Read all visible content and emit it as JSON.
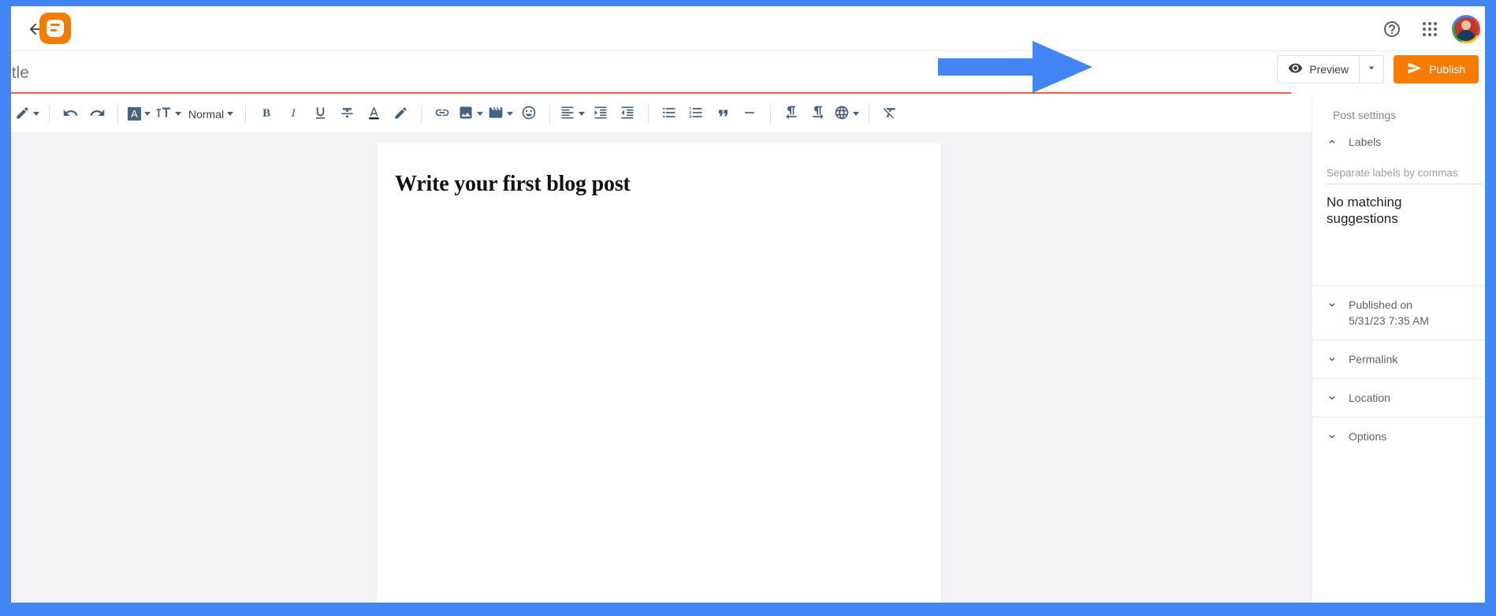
{
  "app": {
    "name": "Blogger",
    "accent_orange": "#f57c00",
    "annotation_color": "#4285f4",
    "title_underline_color": "#e8643c",
    "toolbar_icon_color": "#46637f"
  },
  "appbar": {
    "back_icon": "arrow-back-icon",
    "logo_icon": "blogger-logo-icon",
    "help_icon": "help-icon",
    "apps_icon": "apps-grid-icon",
    "avatar_icon": "account-avatar"
  },
  "title": {
    "placeholder": "Title",
    "value": ""
  },
  "actions": {
    "preview_label": "Preview",
    "preview_icon": "eye-icon",
    "preview_caret_icon": "chevron-down-icon",
    "publish_label": "Publish",
    "publish_icon": "send-icon"
  },
  "toolbar": {
    "items": [
      {
        "name": "edit-mode",
        "icon": "pencil-icon",
        "caret": true
      },
      {
        "name": "separator-1",
        "icon": "separator",
        "caret": false
      },
      {
        "name": "undo",
        "icon": "undo-icon",
        "caret": false
      },
      {
        "name": "redo",
        "icon": "redo-icon",
        "caret": false
      },
      {
        "name": "separator-2",
        "icon": "separator",
        "caret": false
      },
      {
        "name": "font-family",
        "icon": "letter-a-box-icon",
        "caret": true
      },
      {
        "name": "font-size",
        "icon": "format-size-icon",
        "caret": true
      },
      {
        "name": "paragraph-style",
        "icon": "text-label",
        "label": "Normal",
        "caret": true
      },
      {
        "name": "separator-3",
        "icon": "separator",
        "caret": false
      },
      {
        "name": "bold",
        "icon": "bold-icon",
        "label": "B",
        "caret": false
      },
      {
        "name": "italic",
        "icon": "italic-icon",
        "label": "I",
        "caret": false
      },
      {
        "name": "underline",
        "icon": "underline-icon",
        "caret": false
      },
      {
        "name": "strikethrough",
        "icon": "strikethrough-icon",
        "caret": false
      },
      {
        "name": "text-color",
        "icon": "text-color-icon",
        "caret": false
      },
      {
        "name": "highlight-color",
        "icon": "highlighter-icon",
        "caret": false
      },
      {
        "name": "separator-4",
        "icon": "separator",
        "caret": false
      },
      {
        "name": "insert-link",
        "icon": "link-icon",
        "caret": false
      },
      {
        "name": "insert-image",
        "icon": "image-icon",
        "caret": true
      },
      {
        "name": "insert-video",
        "icon": "video-icon",
        "caret": true
      },
      {
        "name": "insert-emoji",
        "icon": "emoji-icon",
        "caret": false
      },
      {
        "name": "separator-5",
        "icon": "separator",
        "caret": false
      },
      {
        "name": "align",
        "icon": "align-left-icon",
        "caret": true
      },
      {
        "name": "increase-indent",
        "icon": "indent-increase-icon",
        "caret": false
      },
      {
        "name": "decrease-indent",
        "icon": "indent-decrease-icon",
        "caret": false
      },
      {
        "name": "separator-6",
        "icon": "separator",
        "caret": false
      },
      {
        "name": "bulleted-list",
        "icon": "bulleted-list-icon",
        "caret": false
      },
      {
        "name": "numbered-list",
        "icon": "numbered-list-icon",
        "caret": false
      },
      {
        "name": "blockquote",
        "icon": "quote-icon",
        "caret": false
      },
      {
        "name": "insert-jump-break",
        "icon": "horizontal-rule-icon",
        "caret": false
      },
      {
        "name": "separator-7",
        "icon": "separator",
        "caret": false
      },
      {
        "name": "left-to-right",
        "icon": "ltr-icon",
        "caret": false
      },
      {
        "name": "right-to-left",
        "icon": "rtl-icon",
        "caret": false
      },
      {
        "name": "transliteration",
        "icon": "globe-icon",
        "caret": true
      },
      {
        "name": "separator-8",
        "icon": "separator",
        "caret": false
      },
      {
        "name": "clear-formatting",
        "icon": "clear-formatting-icon",
        "caret": false
      }
    ],
    "paragraph_style_label": "Normal",
    "bold_label": "B",
    "italic_label": "I",
    "font_box_label": "A"
  },
  "editor": {
    "post_heading": "Write your first blog post"
  },
  "panel": {
    "heading": "Post settings",
    "labels": {
      "label": "Labels",
      "chevron": "chevron-up-icon",
      "expanded": true,
      "input_placeholder": "Separate labels by commas",
      "input_value": "",
      "suggestion_text": "No matching suggestions"
    },
    "rows": [
      {
        "name": "published-on",
        "chevron": "chevron-down-icon",
        "label": "Published on",
        "sublabel": "5/31/23 7:35 AM"
      },
      {
        "name": "permalink",
        "chevron": "chevron-down-icon",
        "label": "Permalink",
        "sublabel": ""
      },
      {
        "name": "location",
        "chevron": "chevron-down-icon",
        "label": "Location",
        "sublabel": ""
      },
      {
        "name": "options",
        "chevron": "chevron-down-icon",
        "label": "Options",
        "sublabel": ""
      }
    ]
  }
}
